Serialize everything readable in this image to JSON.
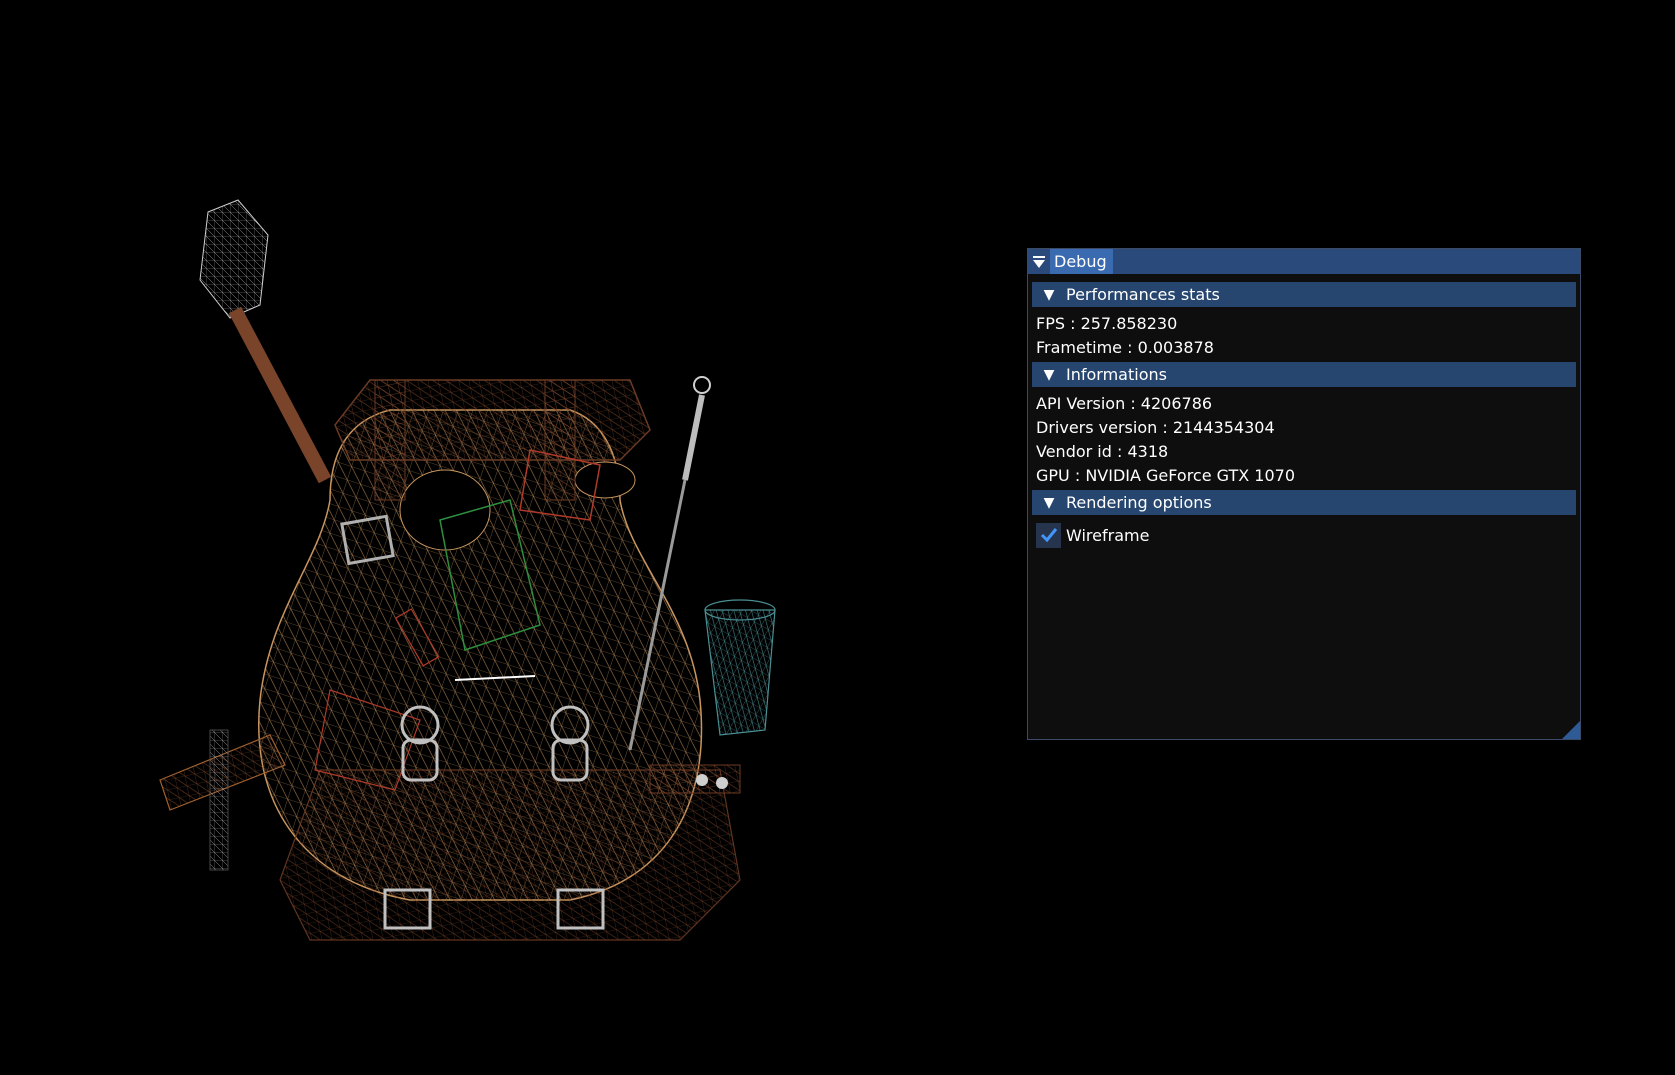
{
  "window": {
    "title": "Debug",
    "collapse_icon": "collapse-arrow-icon"
  },
  "sections": {
    "performance": {
      "header": "Performances stats",
      "fps": "FPS : 257.858230",
      "frametime": "Frametime : 0.003878"
    },
    "informations": {
      "header": "Informations",
      "api_version": "API Version : 4206786",
      "drivers_version": "Drivers version : 2144354304",
      "vendor_id": "Vendor id : 4318",
      "gpu": "GPU : NVIDIA GeForce GTX 1070"
    },
    "rendering": {
      "header": "Rendering options",
      "wireframe_label": "Wireframe",
      "wireframe_checked": true
    }
  },
  "colors": {
    "title_bar": "#294a7a",
    "title_active": "#3a6bb0",
    "header_bg": "#26466f",
    "window_bg": "#0f0f0f",
    "checkmark": "#4296fa",
    "wire_main": "#c8955f",
    "wire_dark": "#6b3a24",
    "wire_grey": "#b0b0b0",
    "wire_teal": "#4a8f94",
    "wire_red": "#b03a2a",
    "wire_green": "#2e8f3e"
  }
}
